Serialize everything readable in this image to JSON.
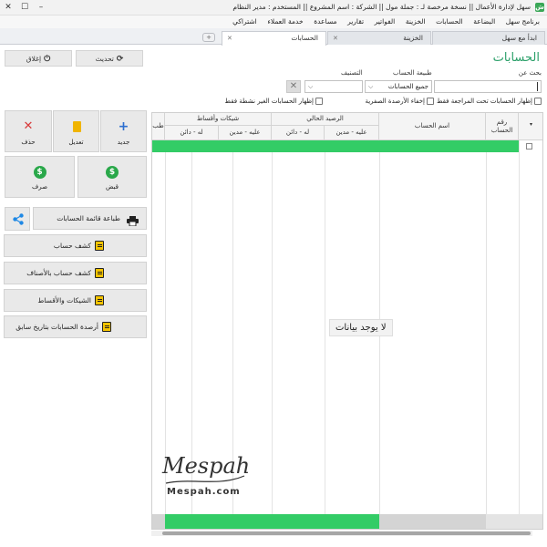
{
  "window": {
    "title": "سهل لإدارة الأعمال  ||  نسخة مرخصة لـ : جملة مول  ||  الشركة : اسم المشروع  ||  المستخدم : مدير النظام",
    "app_icon": "ش"
  },
  "menu": [
    "برنامج سهل",
    "البضاعة",
    "الحسابات",
    "الخزينة",
    "الفواتير",
    "تقارير",
    "مساعدة",
    "خدمة العملاء",
    "اشتراكي"
  ],
  "tabs": [
    {
      "label": "ابدأ مع سهل",
      "active": false
    },
    {
      "label": "الخزينة",
      "active": false
    },
    {
      "label": "الحسابات",
      "active": true
    }
  ],
  "toolbar": {
    "refresh": "تحديث",
    "close": "إغلاق"
  },
  "page": {
    "title": "الحسابات"
  },
  "filters": {
    "search_label": "بحث عن",
    "search_value": "",
    "account_type_label": "طبيعة الحساب",
    "account_type_value": "جميع الحسابات",
    "classification_label": "التصنيف",
    "classification_value": "",
    "chk_review": "إظهار الحسابات تحت المراجعة فقط",
    "chk_zero": "إخفاء الأرصدة الصفرية",
    "chk_inactive": "إظهار الحسابات الغير نشطة فقط"
  },
  "actions": {
    "new": "جديد",
    "edit": "تعديل",
    "delete": "حذف",
    "receipt": "قبض",
    "payment": "صرف",
    "print_list": "طباعة قائمة الحسابات",
    "statement": "كشف حساب",
    "statement_items": "كشف حساب بالأصناف",
    "cheques": "الشيكات والأقساط",
    "balances_date": "أرصدة الحسابات بتاريخ سابق"
  },
  "grid": {
    "col_number": "رقم الحساب",
    "col_name": "اسم الحساب",
    "group_balance": "الرصيد الحالي",
    "group_cheques": "شيكات وأقساط",
    "debit": "عليه - مدين",
    "credit": "له - دائن",
    "partial_col": "طب",
    "no_data": "لا يوجد بيانات"
  },
  "watermark": {
    "script": "Mespah",
    "site": "Mespah.com"
  },
  "colors": {
    "accent_green": "#2ca06a",
    "row_green": "#33cc66"
  }
}
